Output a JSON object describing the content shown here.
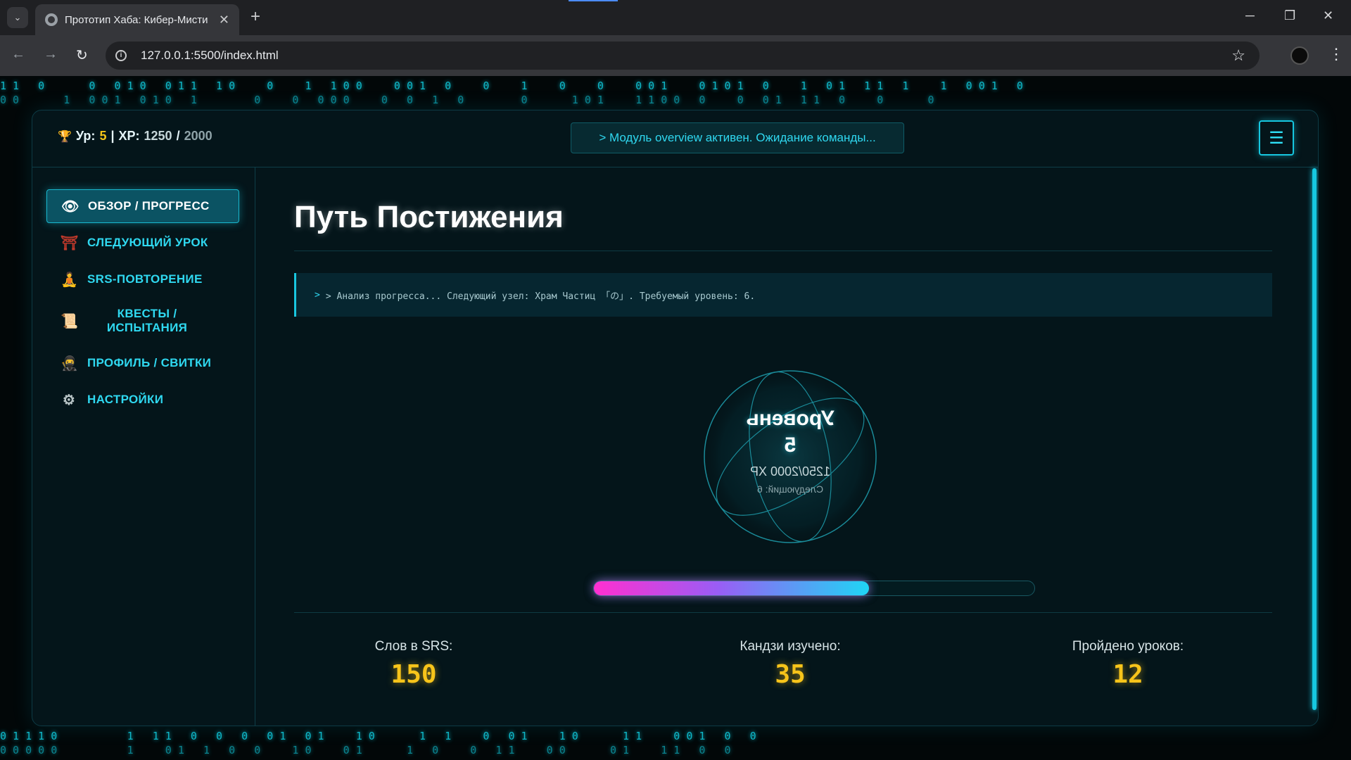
{
  "browser": {
    "tab_title": "Прототип Хаба: Кибер-Мисти",
    "tab_close": "✕",
    "new_tab": "+",
    "url": "127.0.0.1:5500/index.html",
    "minimize": "─",
    "maximize": "❐",
    "close": "✕",
    "back": "←",
    "forward": "→",
    "reload": "↻",
    "info": "i",
    "star": "☆",
    "kebab": "⋮",
    "tab_search": "⌄"
  },
  "header": {
    "trophy_icon": "🏆",
    "level_prefix": "Ур:",
    "level": "5",
    "separator": "|",
    "xp_prefix": "XP:",
    "xp_current": "1250",
    "xp_slash": "/",
    "xp_max": "2000",
    "terminal_message": "> Модуль overview активен. Ожидание команды...",
    "menu_icon": "☰"
  },
  "sidebar": {
    "items": [
      {
        "label": "ОБЗОР / ПРОГРЕСС",
        "icon": "👁",
        "icon_name": "eye-icon",
        "active": true
      },
      {
        "label": "СЛЕДУЮЩИЙ УРОК",
        "icon": "⛩",
        "icon_name": "torii-gate-icon",
        "active": false
      },
      {
        "label": "SRS-ПОВТОРЕНИЕ",
        "icon": "🧘",
        "icon_name": "meditation-icon",
        "active": false
      },
      {
        "label": "КВЕСТЫ / ИСПЫТАНИЯ",
        "icon": "📜",
        "icon_name": "scroll-icon",
        "active": false
      },
      {
        "label": "ПРОФИЛЬ / СВИТКИ",
        "icon": "🥷",
        "icon_name": "ninja-icon",
        "active": false
      },
      {
        "label": "НАСТРОЙКИ",
        "icon": "⚙",
        "icon_name": "gear-icon",
        "active": false
      }
    ]
  },
  "main": {
    "title": "Путь Постижения",
    "analysis_caret": ">",
    "analysis_text": "> Анализ прогресса... Следующий узел: Храм Частиц 「の」. Требуемый уровень: 6.",
    "orb": {
      "level_label": "Уровень",
      "level_value": "5",
      "xp": "1250/2000 XP",
      "next": "Следующий: 6"
    },
    "progress": 0.625,
    "stats": [
      {
        "label": "Слов в SRS:",
        "value": "150"
      },
      {
        "label": "Кандзи изучено:",
        "value": "35"
      },
      {
        "label": "Пройдено уроков:",
        "value": "12"
      }
    ]
  },
  "colors": {
    "accent": "#16c7e0",
    "gold": "#f5c518",
    "magenta": "#ff2fd0",
    "rain": "#0fb8c8"
  },
  "rain": {
    "top_row_1": "1 1   0       0   0 1 0   0 1 1   1 0     0     1   1 0 0     0 0 1   0     0     1     0     0     0 0 1     0 1 0 1   0     1   0 1   1 1   1     1   0 0 1   0",
    "top_row_2": "0 0       1   0 0 1   0 1 0   1         0     0   0 0 0     0   0   1   0         0       1 0 1     1 1 0 0   0     0   0 1   1 1   0     0       0",
    "bottom_row_1": "0 1 1 1 0           1   1 1   0   0   0   0 1   0 1     1 0       1   1     0   0 1     1 0       1 1     0 0 1   0   0",
    "bottom_row_2": "0 0 0 0 0           1     0 1   1   0   0     1 0     0 1       1   0     0   1 1     0 0       0 1     1 1   0   0"
  }
}
